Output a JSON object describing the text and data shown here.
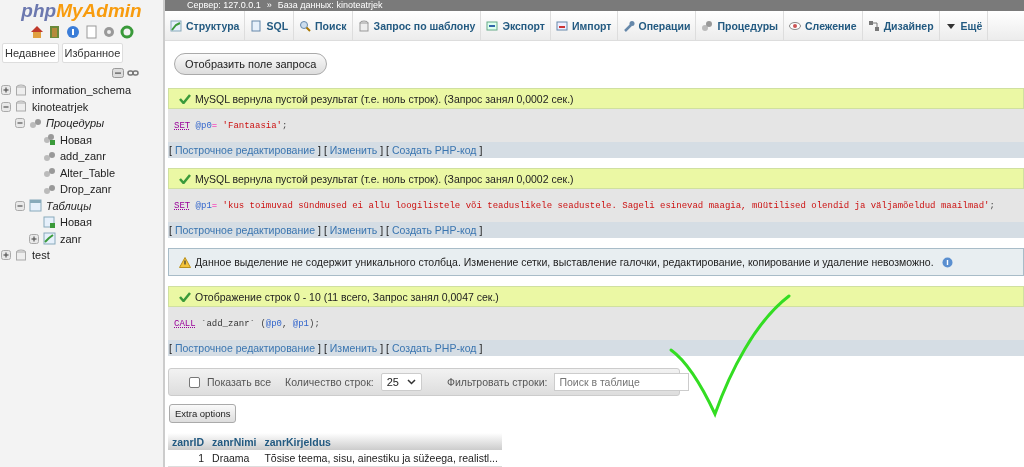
{
  "sidebar": {
    "logo": {
      "part_1": "php",
      "part_2": "MyAdmin"
    },
    "tabs": [
      {
        "label": "Недавнее"
      },
      {
        "label": "Избранное"
      }
    ],
    "tree": [
      {
        "kind": "database",
        "label": "information_schema",
        "expanded": false
      },
      {
        "kind": "database",
        "label": "kinoteatrjek",
        "expanded": true,
        "children": [
          {
            "kind": "procedures",
            "label": "Процедуры",
            "expanded": true,
            "children": [
              {
                "kind": "new-procedure",
                "label": "Новая"
              },
              {
                "kind": "procedure",
                "label": "add_zanr"
              },
              {
                "kind": "procedure",
                "label": "Alter_Table"
              },
              {
                "kind": "procedure",
                "label": "Drop_zanr"
              }
            ]
          },
          {
            "kind": "tables",
            "label": "Таблицы",
            "expanded": true,
            "children": [
              {
                "kind": "new-table",
                "label": "Новая"
              },
              {
                "kind": "table",
                "label": "zanr",
                "expanded": false
              }
            ]
          }
        ]
      },
      {
        "kind": "database",
        "label": "test",
        "expanded": false
      }
    ]
  },
  "breadcrumb": {
    "server": "Сервер: 127.0.0.1",
    "separator": "»",
    "database": "База данных: kinoteatrjek"
  },
  "tabs": [
    {
      "label": "Структура"
    },
    {
      "label": "SQL"
    },
    {
      "label": "Поиск"
    },
    {
      "label": "Запрос по шаблону"
    },
    {
      "label": "Экспорт"
    },
    {
      "label": "Импорт"
    },
    {
      "label": "Операции"
    },
    {
      "label": "Процедуры"
    },
    {
      "label": "Слежение"
    },
    {
      "label": "Дизайнер"
    },
    {
      "label": "Ещё"
    }
  ],
  "show_query_button": "Отобразить поле запроса",
  "messages": [
    {
      "kind": "success",
      "text": "MySQL вернула пустой результат (т.е. ноль строк). (Запрос занял 0,0002 сек.)",
      "sql": [
        {
          "kind": "keyword",
          "text": "SET",
          "space_after": true
        },
        {
          "kind": "variable",
          "text": "@p0"
        },
        {
          "kind": "operator",
          "text": "=",
          "space_after": true
        },
        {
          "kind": "string",
          "text": "'Fantaasia'"
        },
        {
          "kind": "punct",
          "text": ";"
        }
      ],
      "links": [
        {
          "open": "[",
          "label": "Построчное редактирование",
          "close": "]"
        },
        {
          "open": "[",
          "label": "Изменить",
          "close": "]"
        },
        {
          "open": "[",
          "label": "Создать PHP-код",
          "close": "]"
        }
      ]
    },
    {
      "kind": "success",
      "text": "MySQL вернула пустой результат (т.е. ноль строк). (Запрос занял 0,0002 сек.)",
      "sql": [
        {
          "kind": "keyword",
          "text": "SET",
          "space_after": true
        },
        {
          "kind": "variable",
          "text": "@p1"
        },
        {
          "kind": "operator",
          "text": "=",
          "space_after": true
        },
        {
          "kind": "string",
          "text": "'kus toimuvad sündmused ei allu loogilistele või teaduslikele seadustele. Sageli esinevad maagia, müütilised olendid ja väljamõeldud maailmad'"
        },
        {
          "kind": "punct",
          "text": ";"
        }
      ],
      "links": [
        {
          "open": "[",
          "label": "Построчное редактирование",
          "close": "]"
        },
        {
          "open": "[",
          "label": "Изменить",
          "close": "]"
        },
        {
          "open": "[",
          "label": "Создать PHP-код",
          "close": "]"
        }
      ]
    },
    {
      "kind": "notice",
      "text": "Данное выделение не содержит уникального столбца. Изменение сетки, выставление галочки, редактирование, копирование и удаление невозможно."
    },
    {
      "kind": "success",
      "text": "Отображение строк 0 - 10 (11 всего, Запрос занял 0,0047 сек.)",
      "sql": [
        {
          "kind": "keyword",
          "text": "CALL",
          "space_after": true
        },
        {
          "kind": "ident",
          "text": "`add_zanr`",
          "space_after": true
        },
        {
          "kind": "punct",
          "text": "("
        },
        {
          "kind": "variable",
          "text": "@p0"
        },
        {
          "kind": "punct",
          "text": ",",
          "space_after": true
        },
        {
          "kind": "variable",
          "text": "@p1"
        },
        {
          "kind": "punct",
          "text": ");"
        }
      ],
      "links": [
        {
          "open": "[",
          "label": "Построчное редактирование",
          "close": "]"
        },
        {
          "open": "[",
          "label": "Изменить",
          "close": "]"
        },
        {
          "open": "[",
          "label": "Создать PHP-код",
          "close": "]"
        }
      ]
    }
  ],
  "filter_bar": {
    "show_all": {
      "label": "Показать все",
      "checked": false
    },
    "rows_label": "Количество строк:",
    "rows_value": "25",
    "filter_label": "Фильтровать строки:",
    "filter_placeholder": "Поиск в таблице"
  },
  "extra_options": "Extra options",
  "table": {
    "columns": [
      "zanrID",
      "zanrNimi",
      "zanrKirjeldus"
    ],
    "rows": [
      [
        "1",
        "Draama",
        "Tõsise teema, sisu, ainestiku ja süžeega, realistl..."
      ]
    ]
  }
}
